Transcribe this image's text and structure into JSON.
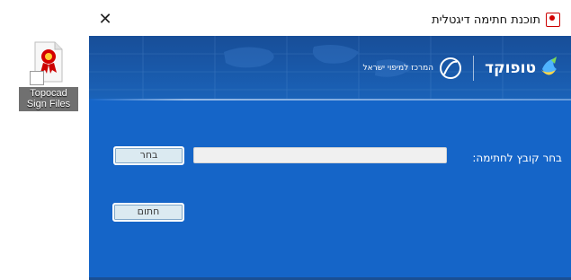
{
  "desktop_icon": {
    "name": "pdf-ribbon-file-icon",
    "label_line1": "Topocad",
    "label_line2": "Sign Files"
  },
  "window": {
    "title": "תוכנת חתימה דיגטלית",
    "close_glyph": "✕"
  },
  "header": {
    "org_text": "המרכז למיפוי ישראל",
    "brand_text": "טופוקד"
  },
  "form": {
    "choose_file_label": "בחר קובץ לחתימה:",
    "file_value": "",
    "file_placeholder": "",
    "choose_button": "בחר",
    "sign_button": "חתום"
  },
  "colors": {
    "client_bg": "#1565c8",
    "banner_bg": "#184e98",
    "button_bg": "#dbeaf1"
  }
}
